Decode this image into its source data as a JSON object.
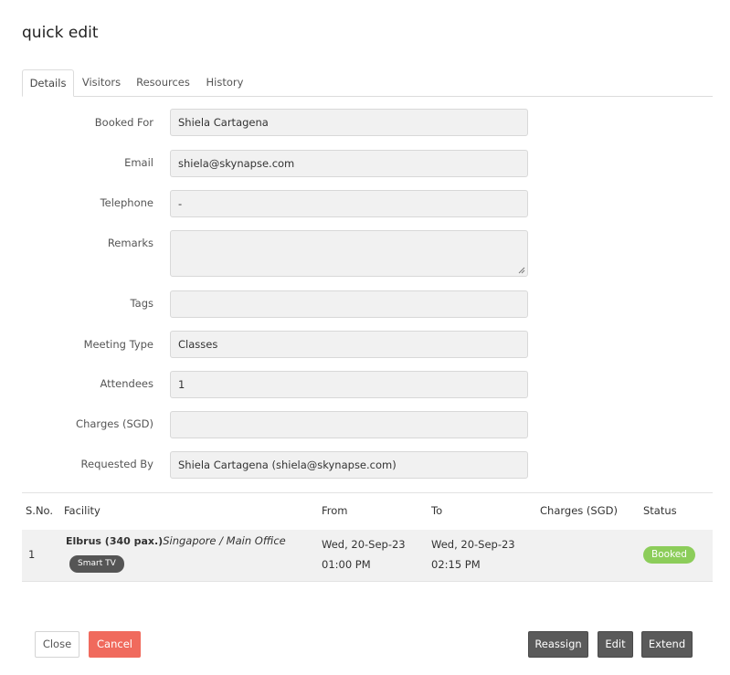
{
  "dialog": {
    "title": "quick edit"
  },
  "tabs": [
    {
      "label": "Details"
    },
    {
      "label": "Visitors"
    },
    {
      "label": "Resources"
    },
    {
      "label": "History"
    }
  ],
  "form": {
    "booked_for": {
      "label": "Booked For",
      "value": "Shiela Cartagena"
    },
    "email": {
      "label": "Email",
      "value": "shiela@skynapse.com"
    },
    "telephone": {
      "label": "Telephone",
      "value": "-"
    },
    "remarks": {
      "label": "Remarks",
      "value": ""
    },
    "tags": {
      "label": "Tags",
      "value": ""
    },
    "meeting_type": {
      "label": "Meeting Type",
      "value": "Classes"
    },
    "attendees": {
      "label": "Attendees",
      "value": "1"
    },
    "charges": {
      "label": "Charges (SGD)",
      "value": ""
    },
    "requested_by": {
      "label": "Requested By",
      "value": "Shiela Cartagena (shiela@skynapse.com)"
    }
  },
  "table": {
    "headers": {
      "sno": "S.No.",
      "facility": "Facility",
      "from": "From",
      "to": "To",
      "charges": "Charges (SGD)",
      "status": "Status"
    },
    "rows": [
      {
        "sno": "1",
        "facility_name": "Elbrus (340 pax.)",
        "facility_location": "Singapore / Main Office",
        "resource_tag": "Smart TV",
        "from_date": "Wed, 20-Sep-23",
        "from_time": "01:00 PM",
        "to_date": "Wed, 20-Sep-23",
        "to_time": "02:15 PM",
        "charges": "",
        "status": "Booked"
      }
    ]
  },
  "footer": {
    "close_label": "Close",
    "cancel_label": "Cancel",
    "reassign_label": "Reassign",
    "edit_label": "Edit",
    "extend_label": "Extend"
  },
  "colors": {
    "cancel": "#f06a5d",
    "booked_status": "#8ccd5a",
    "dark_button": "#5a5a5a"
  }
}
